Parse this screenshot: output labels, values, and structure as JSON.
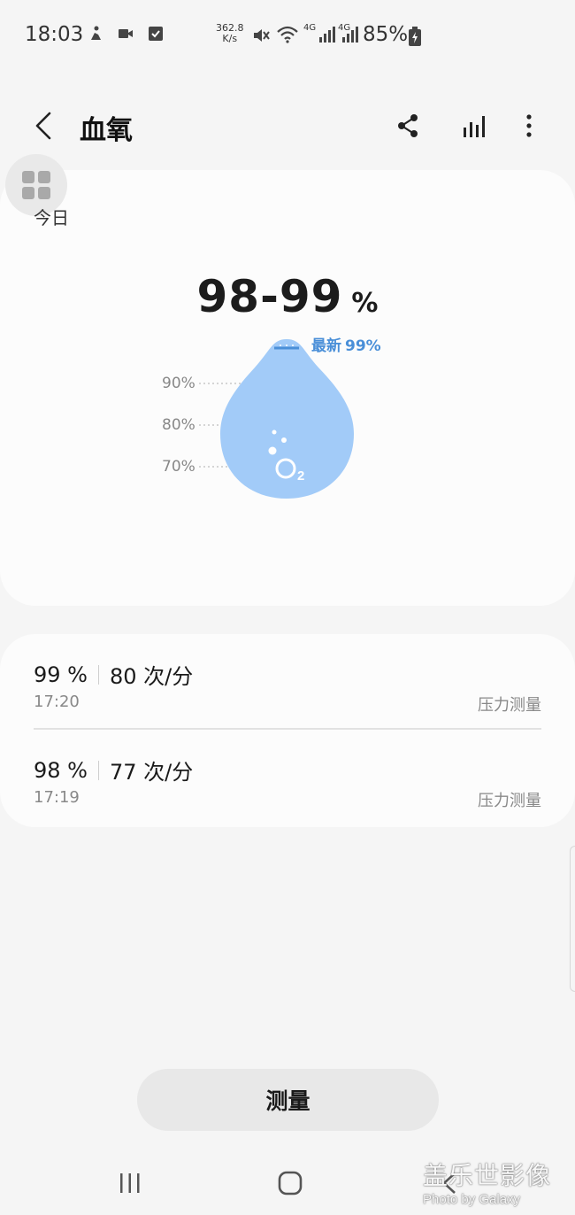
{
  "status_bar": {
    "time": "18:03",
    "net_speed_value": "362.8",
    "net_speed_unit": "K/s",
    "network_4g_1": "4G",
    "network_4g_2": "4G",
    "battery": "85%",
    "icons": [
      "fitness-icon",
      "video-icon",
      "checkbox-icon",
      "mute-icon",
      "wifi-icon",
      "signal-icon",
      "signal-icon",
      "battery-charging-icon"
    ]
  },
  "header": {
    "title": "血氧",
    "icons": [
      "back-arrow-icon",
      "share-icon",
      "stats-icon",
      "more-vertical-icon"
    ]
  },
  "today": {
    "label": "今日",
    "range": "98-99",
    "unit": "%",
    "latest_label": "最新",
    "latest_value": "99%",
    "axis": [
      "90%",
      "80%",
      "70%"
    ],
    "drop_label": "O",
    "drop_subscript": "2"
  },
  "records": [
    {
      "spo2": "99 %",
      "heart_rate": "80 次/分",
      "time": "17:20",
      "type": "压力测量"
    },
    {
      "spo2": "98 %",
      "heart_rate": "77 次/分",
      "time": "17:19",
      "type": "压力测量"
    }
  ],
  "measure_button": "测量",
  "watermark": {
    "main": "盖乐世影像",
    "sub": "Photo by Galaxy"
  },
  "colors": {
    "accent": "#4a8fd8",
    "drop": "#a2cbf8",
    "background": "#f5f5f5",
    "card": "#fcfcfc"
  }
}
